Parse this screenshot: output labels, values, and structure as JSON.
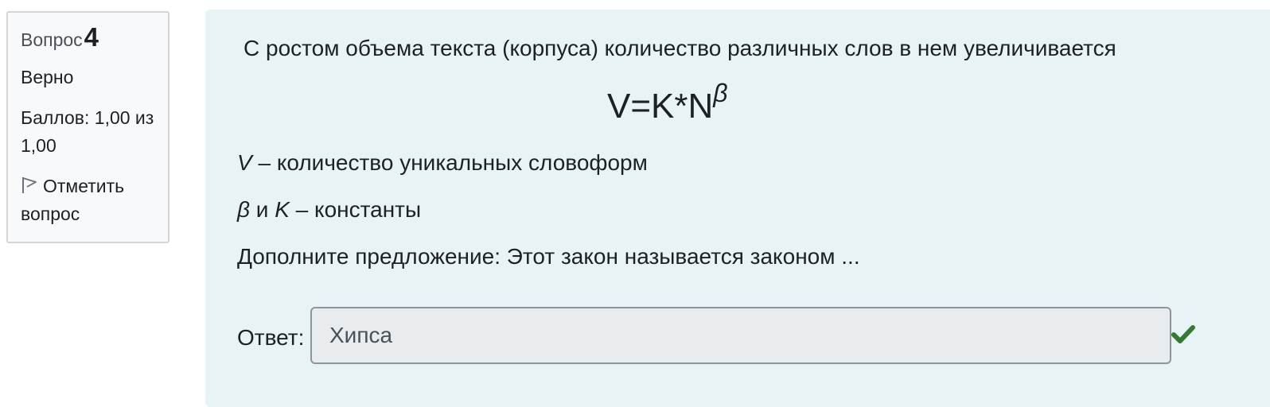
{
  "info": {
    "question_label": "Вопрос",
    "question_number": "4",
    "state": "Верно",
    "grade": "Баллов: 1,00 из 1,00",
    "flag_label": "Отметить вопрос",
    "flag_icon": "flag-icon"
  },
  "question": {
    "text": "С ростом объема текста (корпуса) количество различных слов в нем увеличивается",
    "formula": {
      "base": "V=K*N",
      "exponent": "β"
    },
    "def_v": {
      "symbol": "V",
      "text": " – количество уникальных словоформ"
    },
    "def_constants": {
      "beta": "β",
      "conj": " и ",
      "k": "K",
      "text": " – константы"
    },
    "prompt": "Дополните предложение: Этот закон называется законом ..."
  },
  "answer": {
    "label": "Ответ:",
    "value": "Хипса",
    "status_icon": "check-icon",
    "status_color": "#357a32"
  }
}
